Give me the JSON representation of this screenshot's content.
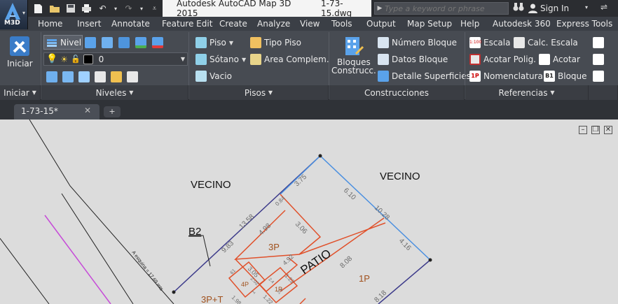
{
  "app": {
    "logo_label": "M3D",
    "title": "Autodesk AutoCAD Map 3D 2015",
    "filename": "1-73-15.dwg"
  },
  "search": {
    "placeholder": "Type a keyword or phrase"
  },
  "account": {
    "sign_in": "Sign In"
  },
  "menu": [
    "Home",
    "Insert",
    "Annotate",
    "Feature Edit",
    "Create",
    "Analyze",
    "View",
    "Tools",
    "Output",
    "Map Setup",
    "Help",
    "Autodesk 360",
    "Express Tools"
  ],
  "ribbon": {
    "iniciar": {
      "button": "Iniciar",
      "title": "Iniciar"
    },
    "niveles": {
      "nivel": "Nivel",
      "layer_value": "0",
      "title": "Niveles"
    },
    "pisos": {
      "piso": "Piso",
      "sotano": "Sótano",
      "vacio": "Vacio",
      "tipo_piso": "Tipo Piso",
      "area": "Area Complem.",
      "title": "Pisos"
    },
    "construcciones": {
      "bloques_line1": "Bloques",
      "bloques_line2": "Construcc.",
      "numero": "Número Bloque",
      "datos": "Datos Bloque",
      "detalle": "Detalle Superficies",
      "title": "Construcciones"
    },
    "referencias": {
      "escala": "Escala",
      "calc": "Calc. Escala",
      "acotar_polig": "Acotar Polig.",
      "acotar": "Acotar",
      "nomenclatura": "Nomenclatura",
      "bloque": "Bloque",
      "title": "Referencias",
      "icon_labels": [
        "1:100",
        "1P",
        "B1"
      ]
    }
  },
  "tabs": {
    "doc": "1-73-15*"
  },
  "drawing": {
    "labels": {
      "vecino1": "VECINO",
      "vecino2": "VECINO",
      "b2": "B2",
      "patio": "PATIO",
      "p3": "3P",
      "p1": "1P",
      "p4": "4P",
      "p1b": "1P",
      "p3t": "3P+T",
      "street": "A esquina = 17.69 mts"
    },
    "dims": {
      "d375": "3.75",
      "d610": "6.10",
      "d1028": "10.28",
      "d1358": "13.58",
      "d084": "0.84",
      "d498": "4.98",
      "d306": "3.06",
      "d983": "9.83",
      "d416": "4.16",
      "d808": "8.08",
      "d492": "4.92",
      "d305": "3.05",
      "d202": "2.02",
      "d122": "1.22",
      "d122b": "1.22",
      "d198": "1.98",
      "d818": "8.18",
      "d61": "61",
      "d1": "1",
      "d24": "2.4",
      "d28": "2.8"
    }
  },
  "colors": {
    "accent_orange": "#e0502a",
    "line_blue": "#4a8fe0",
    "line_purple": "#c64bd8",
    "line_navy": "#3c3a8a",
    "dim_text": "#6b6b6b"
  }
}
